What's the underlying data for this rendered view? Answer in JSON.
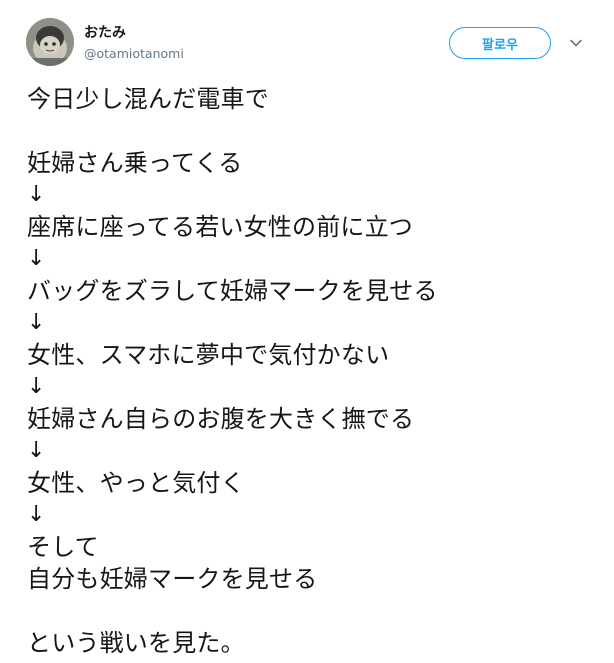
{
  "tweet": {
    "author": {
      "display_name": "おたみ",
      "handle": "@otamiotanomi",
      "avatar": "avatar-image"
    },
    "follow_label": "팔로우",
    "menu_icon": "chevron-down-icon",
    "text_lines": [
      "今日少し混んだ電車で",
      "",
      "妊婦さん乗ってくる",
      "↓",
      "座席に座ってる若い女性の前に立つ",
      "↓",
      "バッグをズラして妊婦マークを見せる",
      "↓",
      "女性、スマホに夢中で気付かない",
      "↓",
      "妊婦さん自らのお腹を大きく撫でる",
      "↓",
      "女性、やっと気付く",
      "↓",
      "そして",
      "自分も妊婦マークを見せる",
      "",
      "という戦いを見た。"
    ]
  },
  "colors": {
    "text": "#14171a",
    "secondary_text": "#657786",
    "accent": "#1da1f2"
  }
}
